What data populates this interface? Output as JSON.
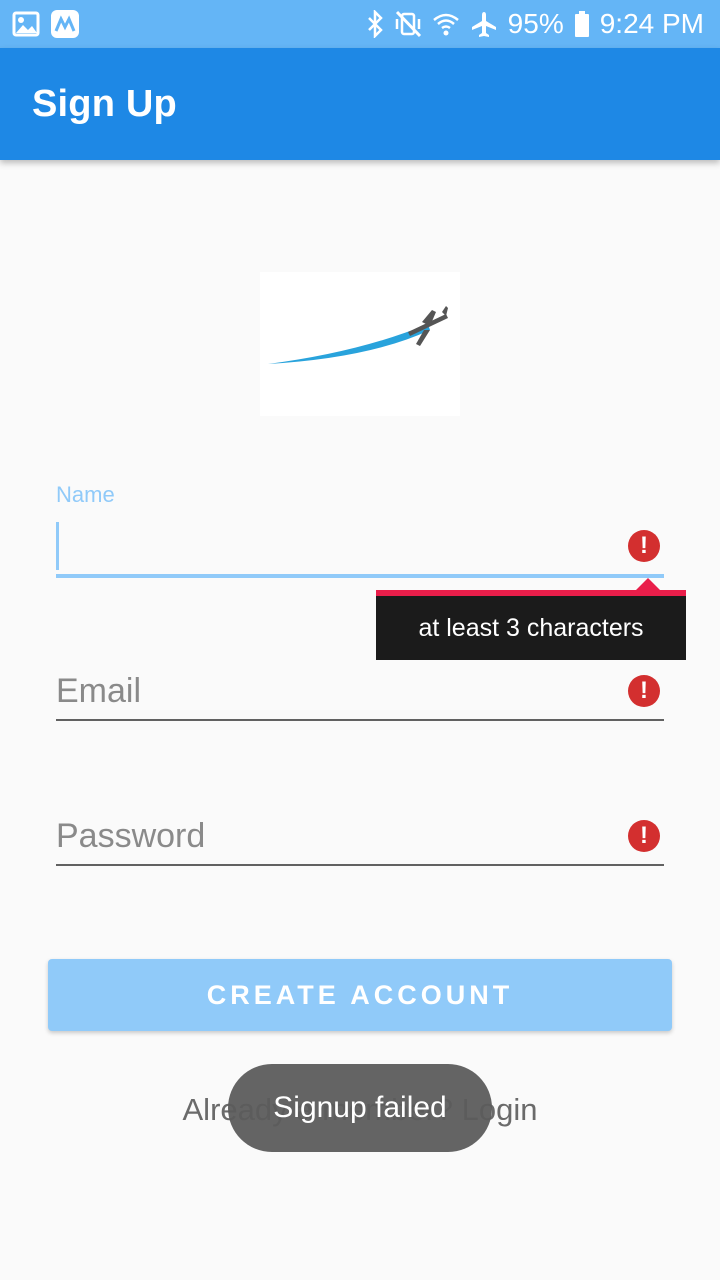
{
  "status_bar": {
    "battery": "95%",
    "time": "9:24 PM",
    "icons": [
      "gallery-icon",
      "app-notification-icon",
      "bluetooth-icon",
      "vibrate-off-icon",
      "wifi-icon",
      "airplane-icon",
      "battery-icon"
    ]
  },
  "app_bar": {
    "title": "Sign Up"
  },
  "form": {
    "name": {
      "label": "Name",
      "value": "",
      "error": "at least 3 characters"
    },
    "email": {
      "placeholder": "Email",
      "value": ""
    },
    "password": {
      "placeholder": "Password",
      "value": ""
    }
  },
  "create_button": {
    "label": "CREATE ACCOUNT"
  },
  "login_link": {
    "text": "Already a member? Login"
  },
  "toast": {
    "text": "Signup failed"
  },
  "colors": {
    "status_bar": "#64b5f6",
    "app_bar": "#1e88e5",
    "accent_light": "#90caf9",
    "error": "#d32f2f",
    "tooltip_bg": "#1b1b1b",
    "tooltip_border": "#e91e4a"
  }
}
